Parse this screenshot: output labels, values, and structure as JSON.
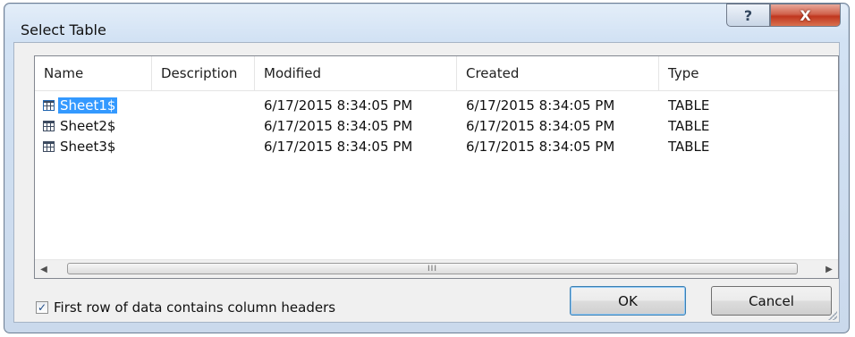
{
  "window": {
    "title": "Select Table",
    "help_label": "?",
    "close_label": "X"
  },
  "table": {
    "columns": [
      "Name",
      "Description",
      "Modified",
      "Created",
      "Type"
    ],
    "rows": [
      {
        "name": "Sheet1$",
        "description": "",
        "modified": "6/17/2015 8:34:05 PM",
        "created": "6/17/2015 8:34:05 PM",
        "type": "TABLE",
        "selected": true,
        "icon": "table-icon"
      },
      {
        "name": "Sheet2$",
        "description": "",
        "modified": "6/17/2015 8:34:05 PM",
        "created": "6/17/2015 8:34:05 PM",
        "type": "TABLE",
        "selected": false,
        "icon": "table-icon"
      },
      {
        "name": "Sheet3$",
        "description": "",
        "modified": "6/17/2015 8:34:05 PM",
        "created": "6/17/2015 8:34:05 PM",
        "type": "TABLE",
        "selected": false,
        "icon": "table-icon"
      }
    ]
  },
  "scrollbar": {
    "left_arrow": "◀",
    "right_arrow": "▶",
    "grip": "III"
  },
  "options": {
    "first_row_headers_label": "First row of data contains column headers",
    "first_row_headers_checked": true
  },
  "buttons": {
    "ok": "OK",
    "cancel": "Cancel"
  },
  "colors": {
    "selection": "#3399ff",
    "close_button": "#c0361e",
    "title_bar": "#d2e2f4"
  }
}
